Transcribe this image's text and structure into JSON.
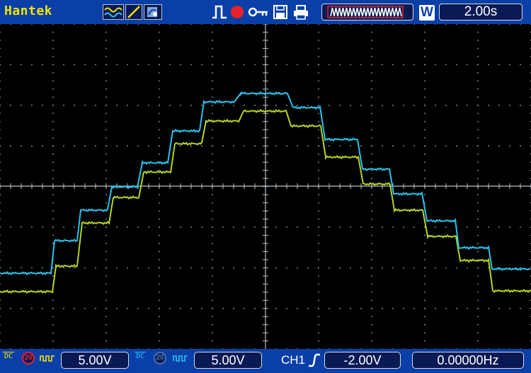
{
  "brand": "Hantek",
  "topbar": {
    "icons": [
      "waveform-mode-icon",
      "persist-mode-icon",
      "display-mode-icon",
      "trigger-pulse-icon",
      "record-icon",
      "key-lock-icon",
      "printer-icon",
      "save-icon"
    ],
    "timebase_mode": "W",
    "timebase": "2.00s"
  },
  "colors": {
    "ch1": "#29c3ee",
    "ch2": "#b4d61e",
    "frame": "#0a3fa8",
    "grid": "#9aa2aa",
    "record": "#e8232a"
  },
  "channels": [
    {
      "name": "ch1",
      "coupling": "DC",
      "bandwidth_limit": "20",
      "probe": "5.00V"
    },
    {
      "name": "ch2",
      "coupling": "DC",
      "bandwidth_limit": "20",
      "probe": "5.00V"
    }
  ],
  "trigger": {
    "source": "CH1",
    "slope": "rising-edge-icon",
    "level": "-2.00V"
  },
  "frequency": "0.00000Hz"
}
